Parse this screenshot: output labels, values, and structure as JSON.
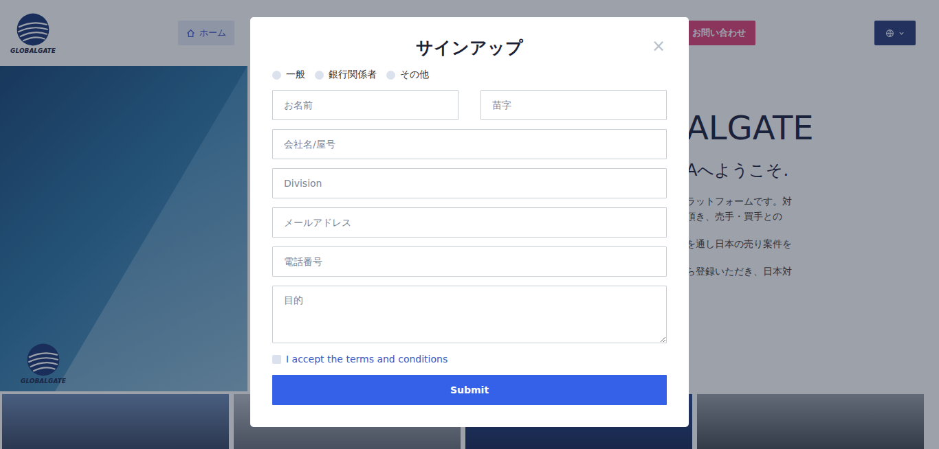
{
  "header": {
    "logo": "GLOBALGATE",
    "nav": [
      {
        "label": "ホーム",
        "selected": true
      }
    ],
    "contact": "お問い合わせ"
  },
  "hero": {
    "title": "ALGATE",
    "subtitle": "Aへようこそ.",
    "paragraphs": [
      [
        "ラットフォームです。対",
        "頂き、売手・買手との"
      ],
      [
        "を通し日本の売り案件を"
      ],
      [
        "ら登録いただき、日本対"
      ]
    ],
    "image_logo": "GLOBALGATE"
  },
  "photos": 4,
  "modal": {
    "title": "サインアップ",
    "close": "×",
    "roles": [
      {
        "label": "一般",
        "selected": false
      },
      {
        "label": "銀行関係者",
        "selected": false
      },
      {
        "label": "その他",
        "selected": false
      }
    ],
    "name_fields": [
      {
        "placeholder": "お名前"
      },
      {
        "placeholder": "苗字"
      }
    ],
    "fields": [
      {
        "placeholder": "会社名/屋号"
      },
      {
        "placeholder": "Division"
      },
      {
        "placeholder": "メールアドレス"
      },
      {
        "placeholder": "電話番号"
      }
    ],
    "purpose": {
      "placeholder": "目的"
    },
    "terms": {
      "label": "I accept the terms and conditions",
      "checked": false
    },
    "submit": "Submit"
  }
}
